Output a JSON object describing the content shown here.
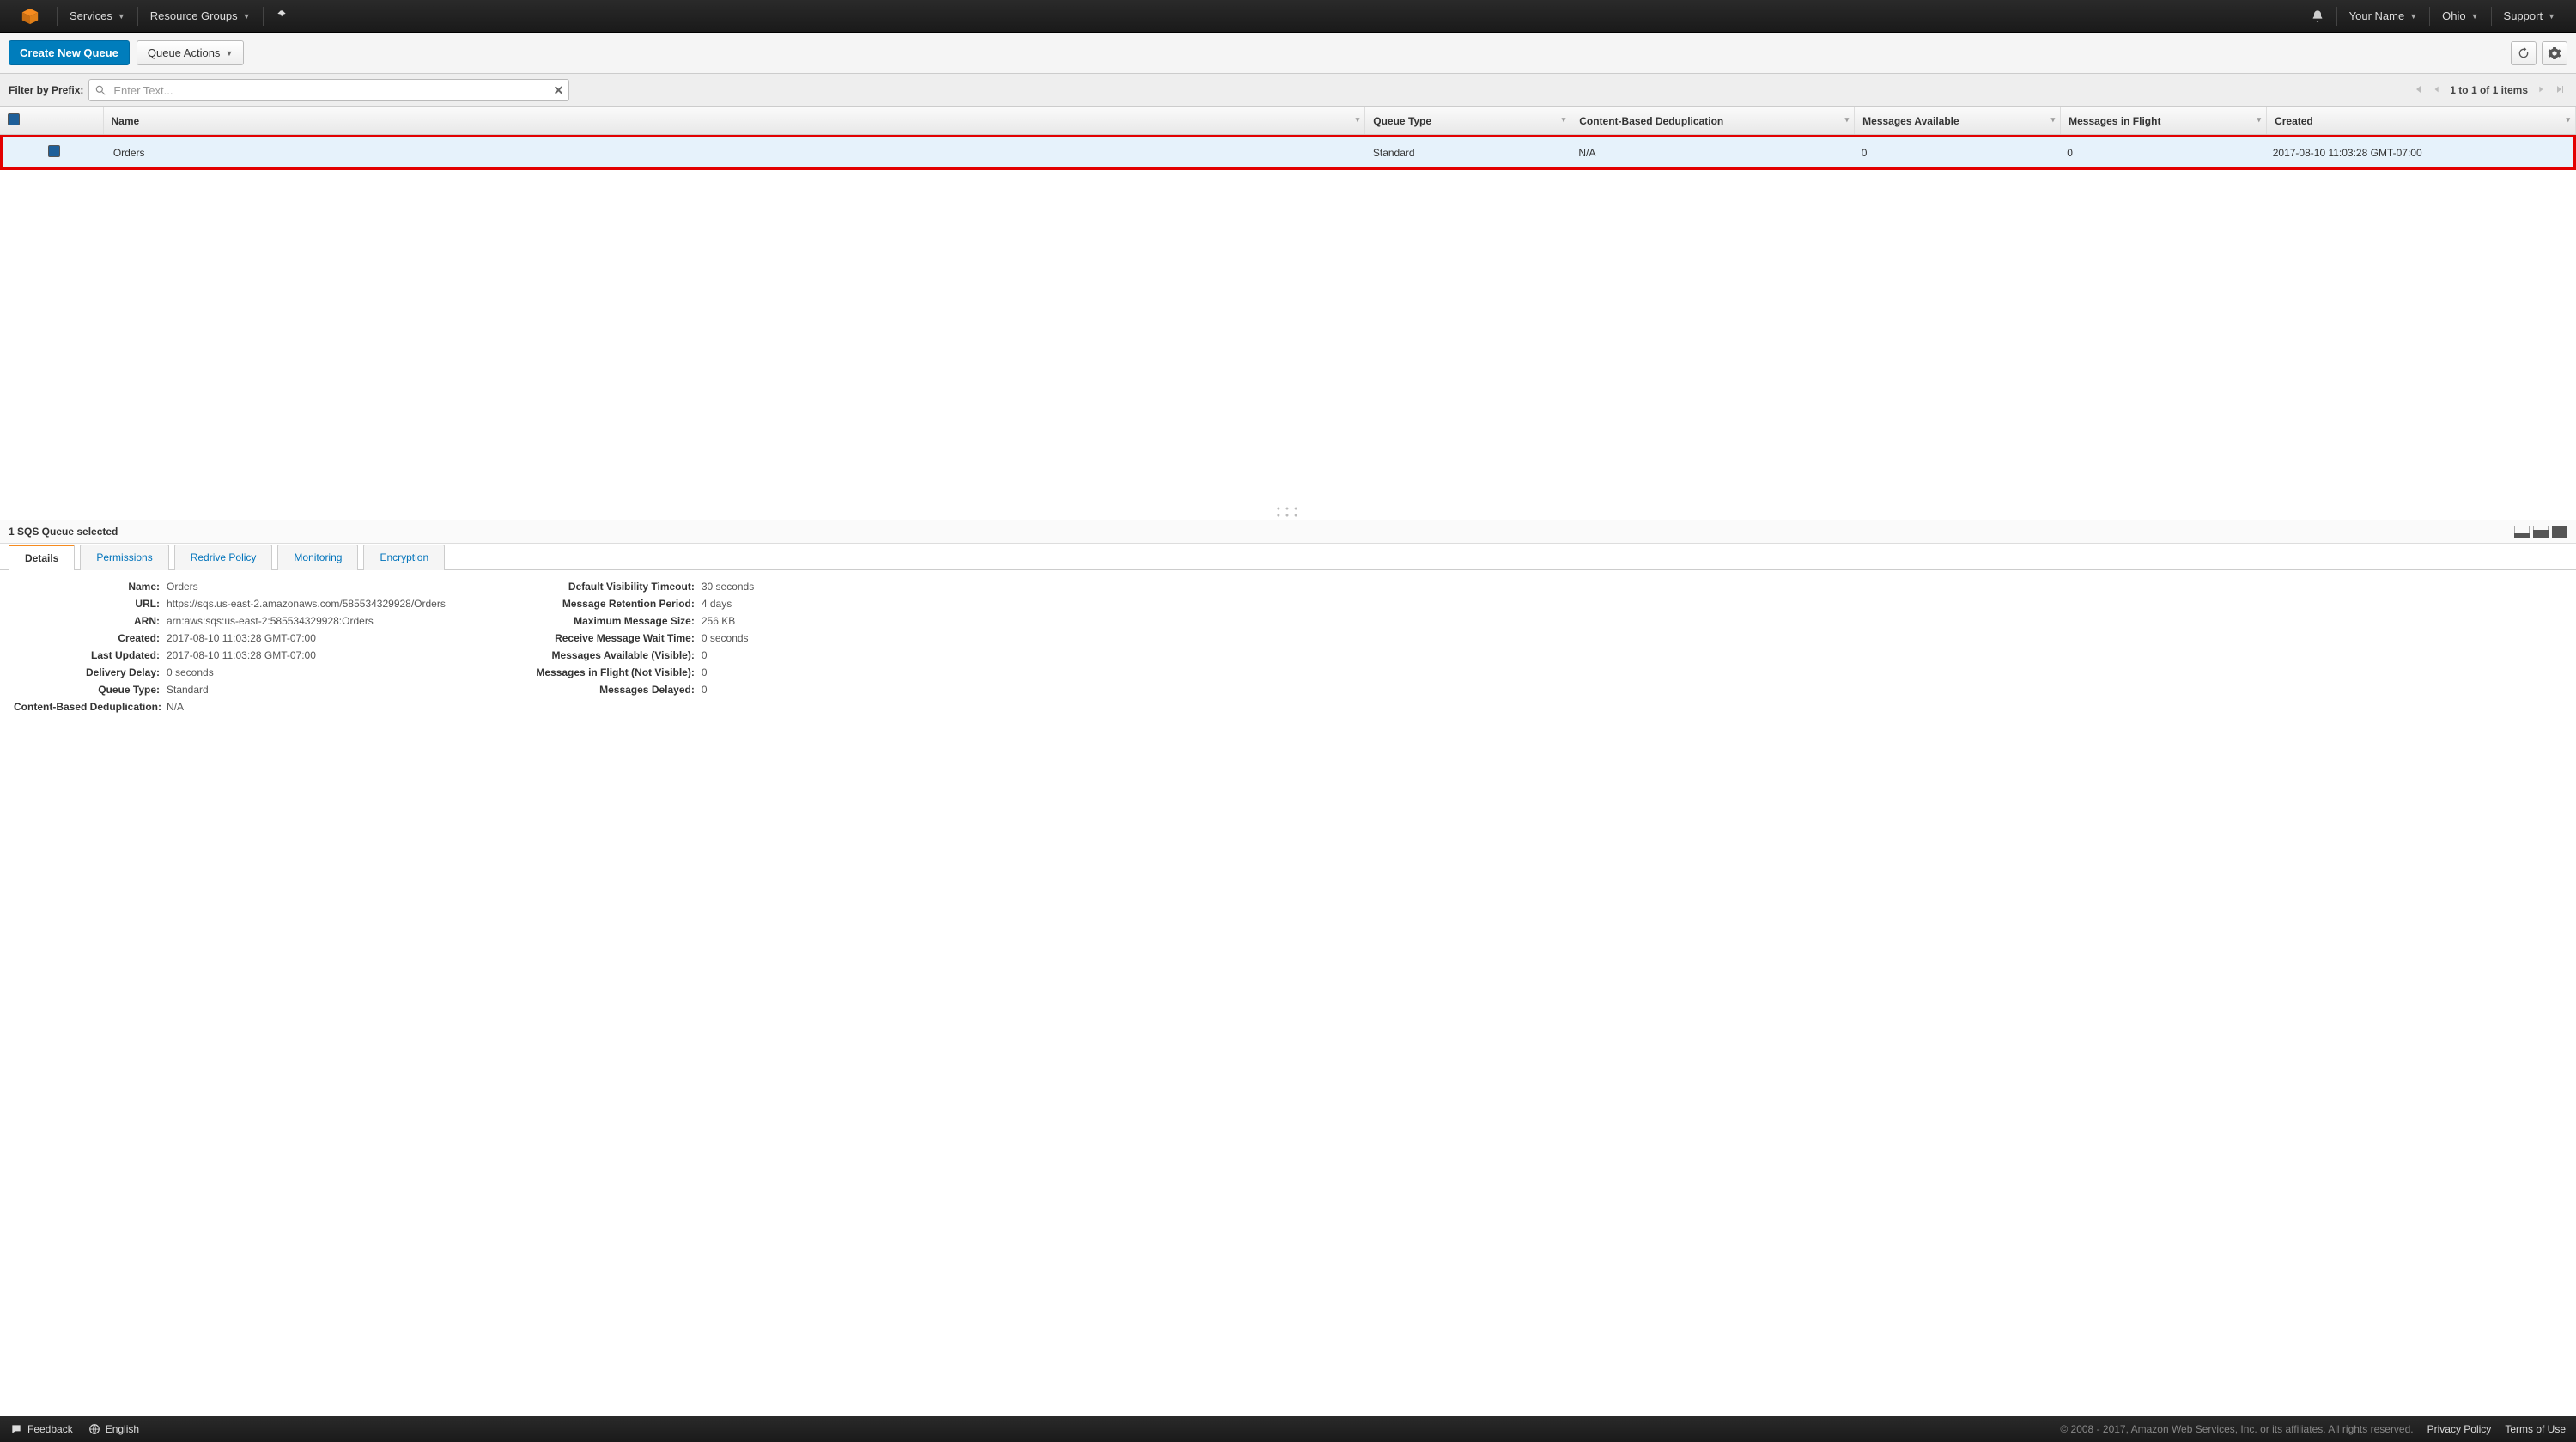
{
  "nav": {
    "services": "Services",
    "resource_groups": "Resource Groups",
    "user": "Your Name",
    "region": "Ohio",
    "support": "Support"
  },
  "toolbar": {
    "create_queue": "Create New Queue",
    "queue_actions": "Queue Actions"
  },
  "filter": {
    "label": "Filter by Prefix:",
    "placeholder": "Enter Text..."
  },
  "pager": {
    "text": "1 to 1 of 1 items"
  },
  "table": {
    "headers": {
      "name": "Name",
      "queue_type": "Queue Type",
      "dedup": "Content-Based Deduplication",
      "msgs_avail": "Messages Available",
      "msgs_flight": "Messages in Flight",
      "created": "Created"
    },
    "row": {
      "name": "Orders",
      "queue_type": "Standard",
      "dedup": "N/A",
      "msgs_avail": "0",
      "msgs_flight": "0",
      "created": "2017-08-10 11:03:28 GMT-07:00"
    }
  },
  "details_header": {
    "selected_text": "1 SQS Queue selected"
  },
  "tabs": {
    "details": "Details",
    "permissions": "Permissions",
    "redrive": "Redrive Policy",
    "monitoring": "Monitoring",
    "encryption": "Encryption"
  },
  "details": {
    "left": {
      "name_k": "Name:",
      "name_v": "Orders",
      "url_k": "URL:",
      "url_v": "https://sqs.us-east-2.amazonaws.com/585534329928/Orders",
      "arn_k": "ARN:",
      "arn_v": "arn:aws:sqs:us-east-2:585534329928:Orders",
      "created_k": "Created:",
      "created_v": "2017-08-10 11:03:28 GMT-07:00",
      "updated_k": "Last Updated:",
      "updated_v": "2017-08-10 11:03:28 GMT-07:00",
      "delay_k": "Delivery Delay:",
      "delay_v": "0 seconds",
      "qtype_k": "Queue Type:",
      "qtype_v": "Standard",
      "dedup_k": "Content-Based Deduplication:",
      "dedup_v": "N/A"
    },
    "right": {
      "vis_k": "Default Visibility Timeout:",
      "vis_v": "30 seconds",
      "ret_k": "Message Retention Period:",
      "ret_v": "4 days",
      "max_k": "Maximum Message Size:",
      "max_v": "256 KB",
      "wait_k": "Receive Message Wait Time:",
      "wait_v": "0 seconds",
      "avail_k": "Messages Available (Visible):",
      "avail_v": "0",
      "flight_k": "Messages in Flight (Not Visible):",
      "flight_v": "0",
      "delayed_k": "Messages Delayed:",
      "delayed_v": "0"
    }
  },
  "footer": {
    "feedback": "Feedback",
    "language": "English",
    "copyright": "© 2008 - 2017, Amazon Web Services, Inc. or its affiliates. All rights reserved.",
    "privacy": "Privacy Policy",
    "terms": "Terms of Use"
  }
}
